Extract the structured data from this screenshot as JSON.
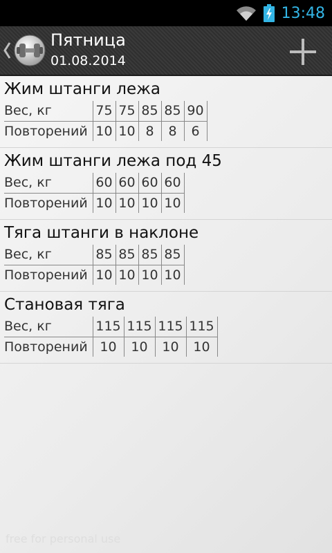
{
  "status_bar": {
    "time": "13:48",
    "icons": [
      "wifi-icon",
      "battery-charging-icon"
    ]
  },
  "action_bar": {
    "title": "Пятница",
    "subtitle": "01.08.2014",
    "icons": [
      "up-caret-icon",
      "dumbbell-icon",
      "add-icon"
    ]
  },
  "labels": {
    "weight": "Вес, кг",
    "reps": "Повторений"
  },
  "exercises": [
    {
      "name": "Жим штанги лежа",
      "weights": [
        "75",
        "75",
        "85",
        "85",
        "90"
      ],
      "reps": [
        "10",
        "10",
        "8",
        "8",
        "6"
      ]
    },
    {
      "name": "Жим штанги лежа под 45",
      "weights": [
        "60",
        "60",
        "60",
        "60"
      ],
      "reps": [
        "10",
        "10",
        "10",
        "10"
      ]
    },
    {
      "name": "Тяга штанги в наклоне",
      "weights": [
        "85",
        "85",
        "85",
        "85"
      ],
      "reps": [
        "10",
        "10",
        "10",
        "10"
      ]
    },
    {
      "name": "Становая тяга",
      "weights": [
        "115",
        "115",
        "115",
        "115"
      ],
      "reps": [
        "10",
        "10",
        "10",
        "10"
      ]
    }
  ],
  "watermark": "free for personal use",
  "colors": {
    "accent": "#33b5e5",
    "action_bar": "#333333"
  }
}
